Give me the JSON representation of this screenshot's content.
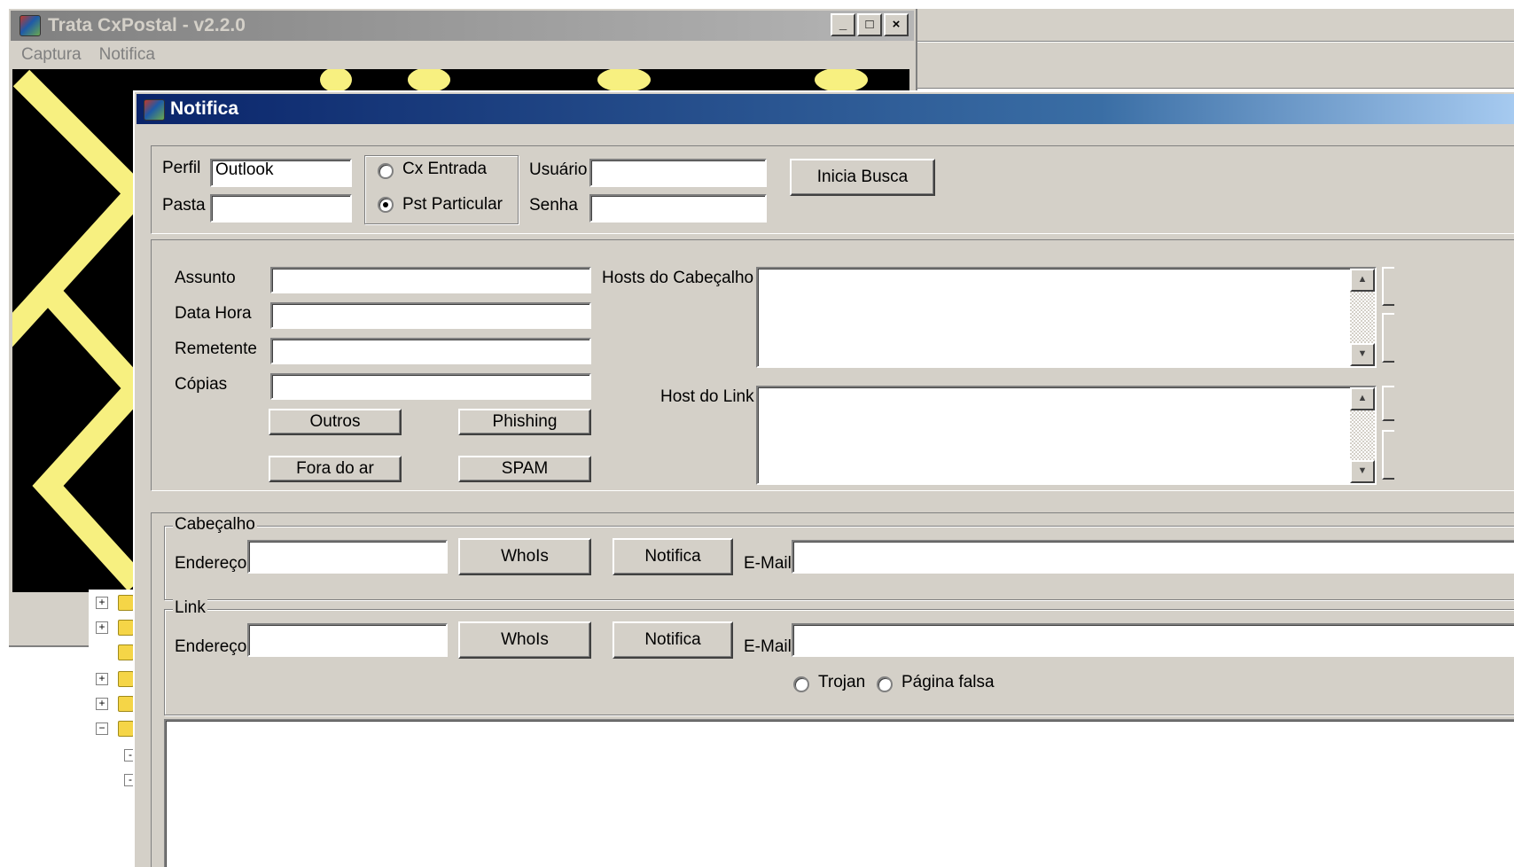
{
  "background_window": {
    "title": "Trata CxPostal - v2.2.0",
    "controls": {
      "minimize": "_",
      "maximize": "□",
      "close": "×"
    },
    "menu": [
      "Captura",
      "Notifica"
    ],
    "accent": "#f7f080"
  },
  "dialog": {
    "title": "Notifica",
    "top": {
      "perfil_label": "Perfil",
      "perfil_value": "Outlook",
      "pasta_label": "Pasta",
      "pasta_value": "",
      "radio_cx_entrada": "Cx Entrada",
      "radio_pst_particular": "Pst Particular",
      "selected_source": "Pst Particular",
      "usuario_label": "Usuário",
      "usuario_value": "",
      "senha_label": "Senha",
      "senha_value": "",
      "inicia_busca": "Inicia Busca"
    },
    "message": {
      "assunto_label": "Assunto",
      "data_hora_label": "Data Hora",
      "remetente_label": "Remetente",
      "copias_label": "Cópias",
      "assunto_value": "",
      "data_hora_value": "",
      "remetente_value": "",
      "copias_value": "",
      "outros": "Outros",
      "phishing": "Phishing",
      "fora_do_ar": "Fora do ar",
      "spam": "SPAM",
      "hosts_cabecalho_label": "Hosts do Cabeçalho",
      "host_link_label": "Host do Link"
    },
    "cabecalho": {
      "title": "Cabeçalho",
      "endereco_label": "Endereço",
      "endereco_value": "",
      "whois": "WhoIs",
      "notifica": "Notifica",
      "email_label": "E-Mail",
      "email_value": ""
    },
    "link": {
      "title": "Link",
      "endereco_label": "Endereço",
      "endereco_value": "",
      "whois": "WhoIs",
      "notifica": "Notifica",
      "email_label": "E-Mail",
      "email_value": "",
      "trojan": "Trojan",
      "pagina_falsa": "Página falsa"
    }
  }
}
